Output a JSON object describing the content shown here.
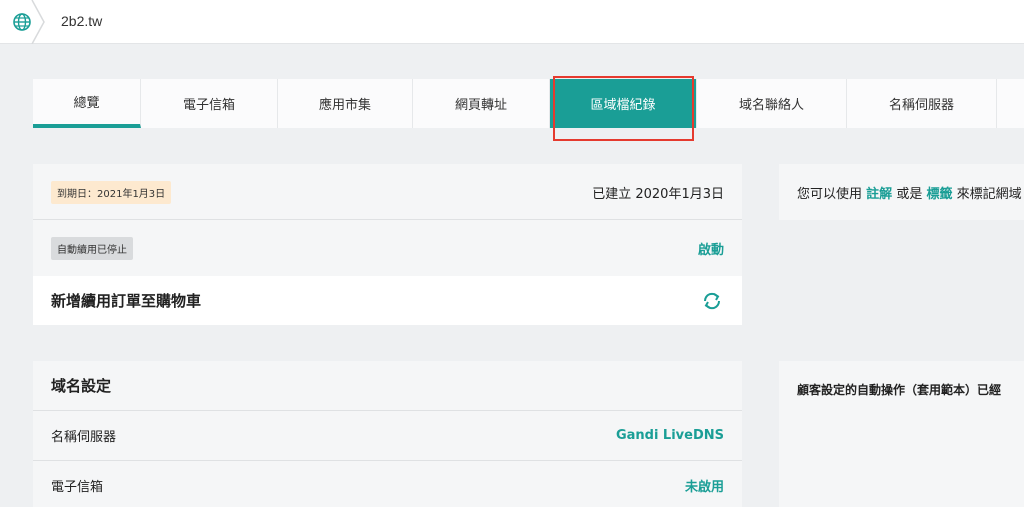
{
  "breadcrumb": {
    "domain": "2b2.tw"
  },
  "tabs": [
    {
      "label": "總覽"
    },
    {
      "label": "電子信箱"
    },
    {
      "label": "應用市集"
    },
    {
      "label": "網頁轉址"
    },
    {
      "label": "區域檔紀錄"
    },
    {
      "label": "域名聯絡人"
    },
    {
      "label": "名稱伺服器"
    }
  ],
  "status_card": {
    "expiry_badge": "到期日：2021年1月3日",
    "created": "已建立 2020年1月3日",
    "autorenew_badge": "自動續用已停止",
    "enable_link": "啟動",
    "add_renewal": "新增續用訂單至購物車"
  },
  "tags_card": {
    "prefix": "您可以使用",
    "notes": "註解",
    "or": "或是",
    "tags": "標籤",
    "suffix": "來標記網域"
  },
  "settings_card": {
    "title": "域名設定",
    "nameservers_label": "名稱伺服器",
    "nameservers_value": "Gandi LiveDNS",
    "email_label": "電子信箱",
    "email_value": "未啟用"
  },
  "automation_card": {
    "text": "顧客設定的自動操作（套用範本）已經"
  },
  "colors": {
    "accent": "#1a9e96",
    "highlight": "#e53a2e"
  }
}
